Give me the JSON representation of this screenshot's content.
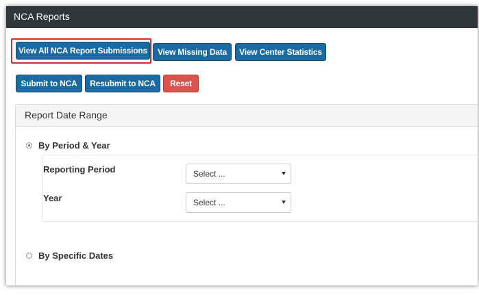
{
  "header": {
    "title": "NCA Reports"
  },
  "toolbar_top": [
    {
      "label": "View All NCA Report Submissions"
    },
    {
      "label": "View Missing Data"
    },
    {
      "label": "View Center Statistics"
    }
  ],
  "toolbar_actions": {
    "submit_label": "Submit to NCA",
    "resubmit_label": "Resubmit to NCA",
    "reset_label": "Reset"
  },
  "colors": {
    "header_bg": "#2f373b",
    "primary": "#1a6aa3",
    "danger": "#d9534f",
    "highlight": "#d62a2a"
  },
  "panel": {
    "heading": "Report Date Range",
    "options": [
      {
        "label": "By Period & Year",
        "checked": true
      },
      {
        "label": "By Specific Dates",
        "checked": false
      }
    ],
    "fields": [
      {
        "label": "Reporting Period",
        "value": "Select ..."
      },
      {
        "label": "Year",
        "value": "Select ..."
      }
    ]
  }
}
